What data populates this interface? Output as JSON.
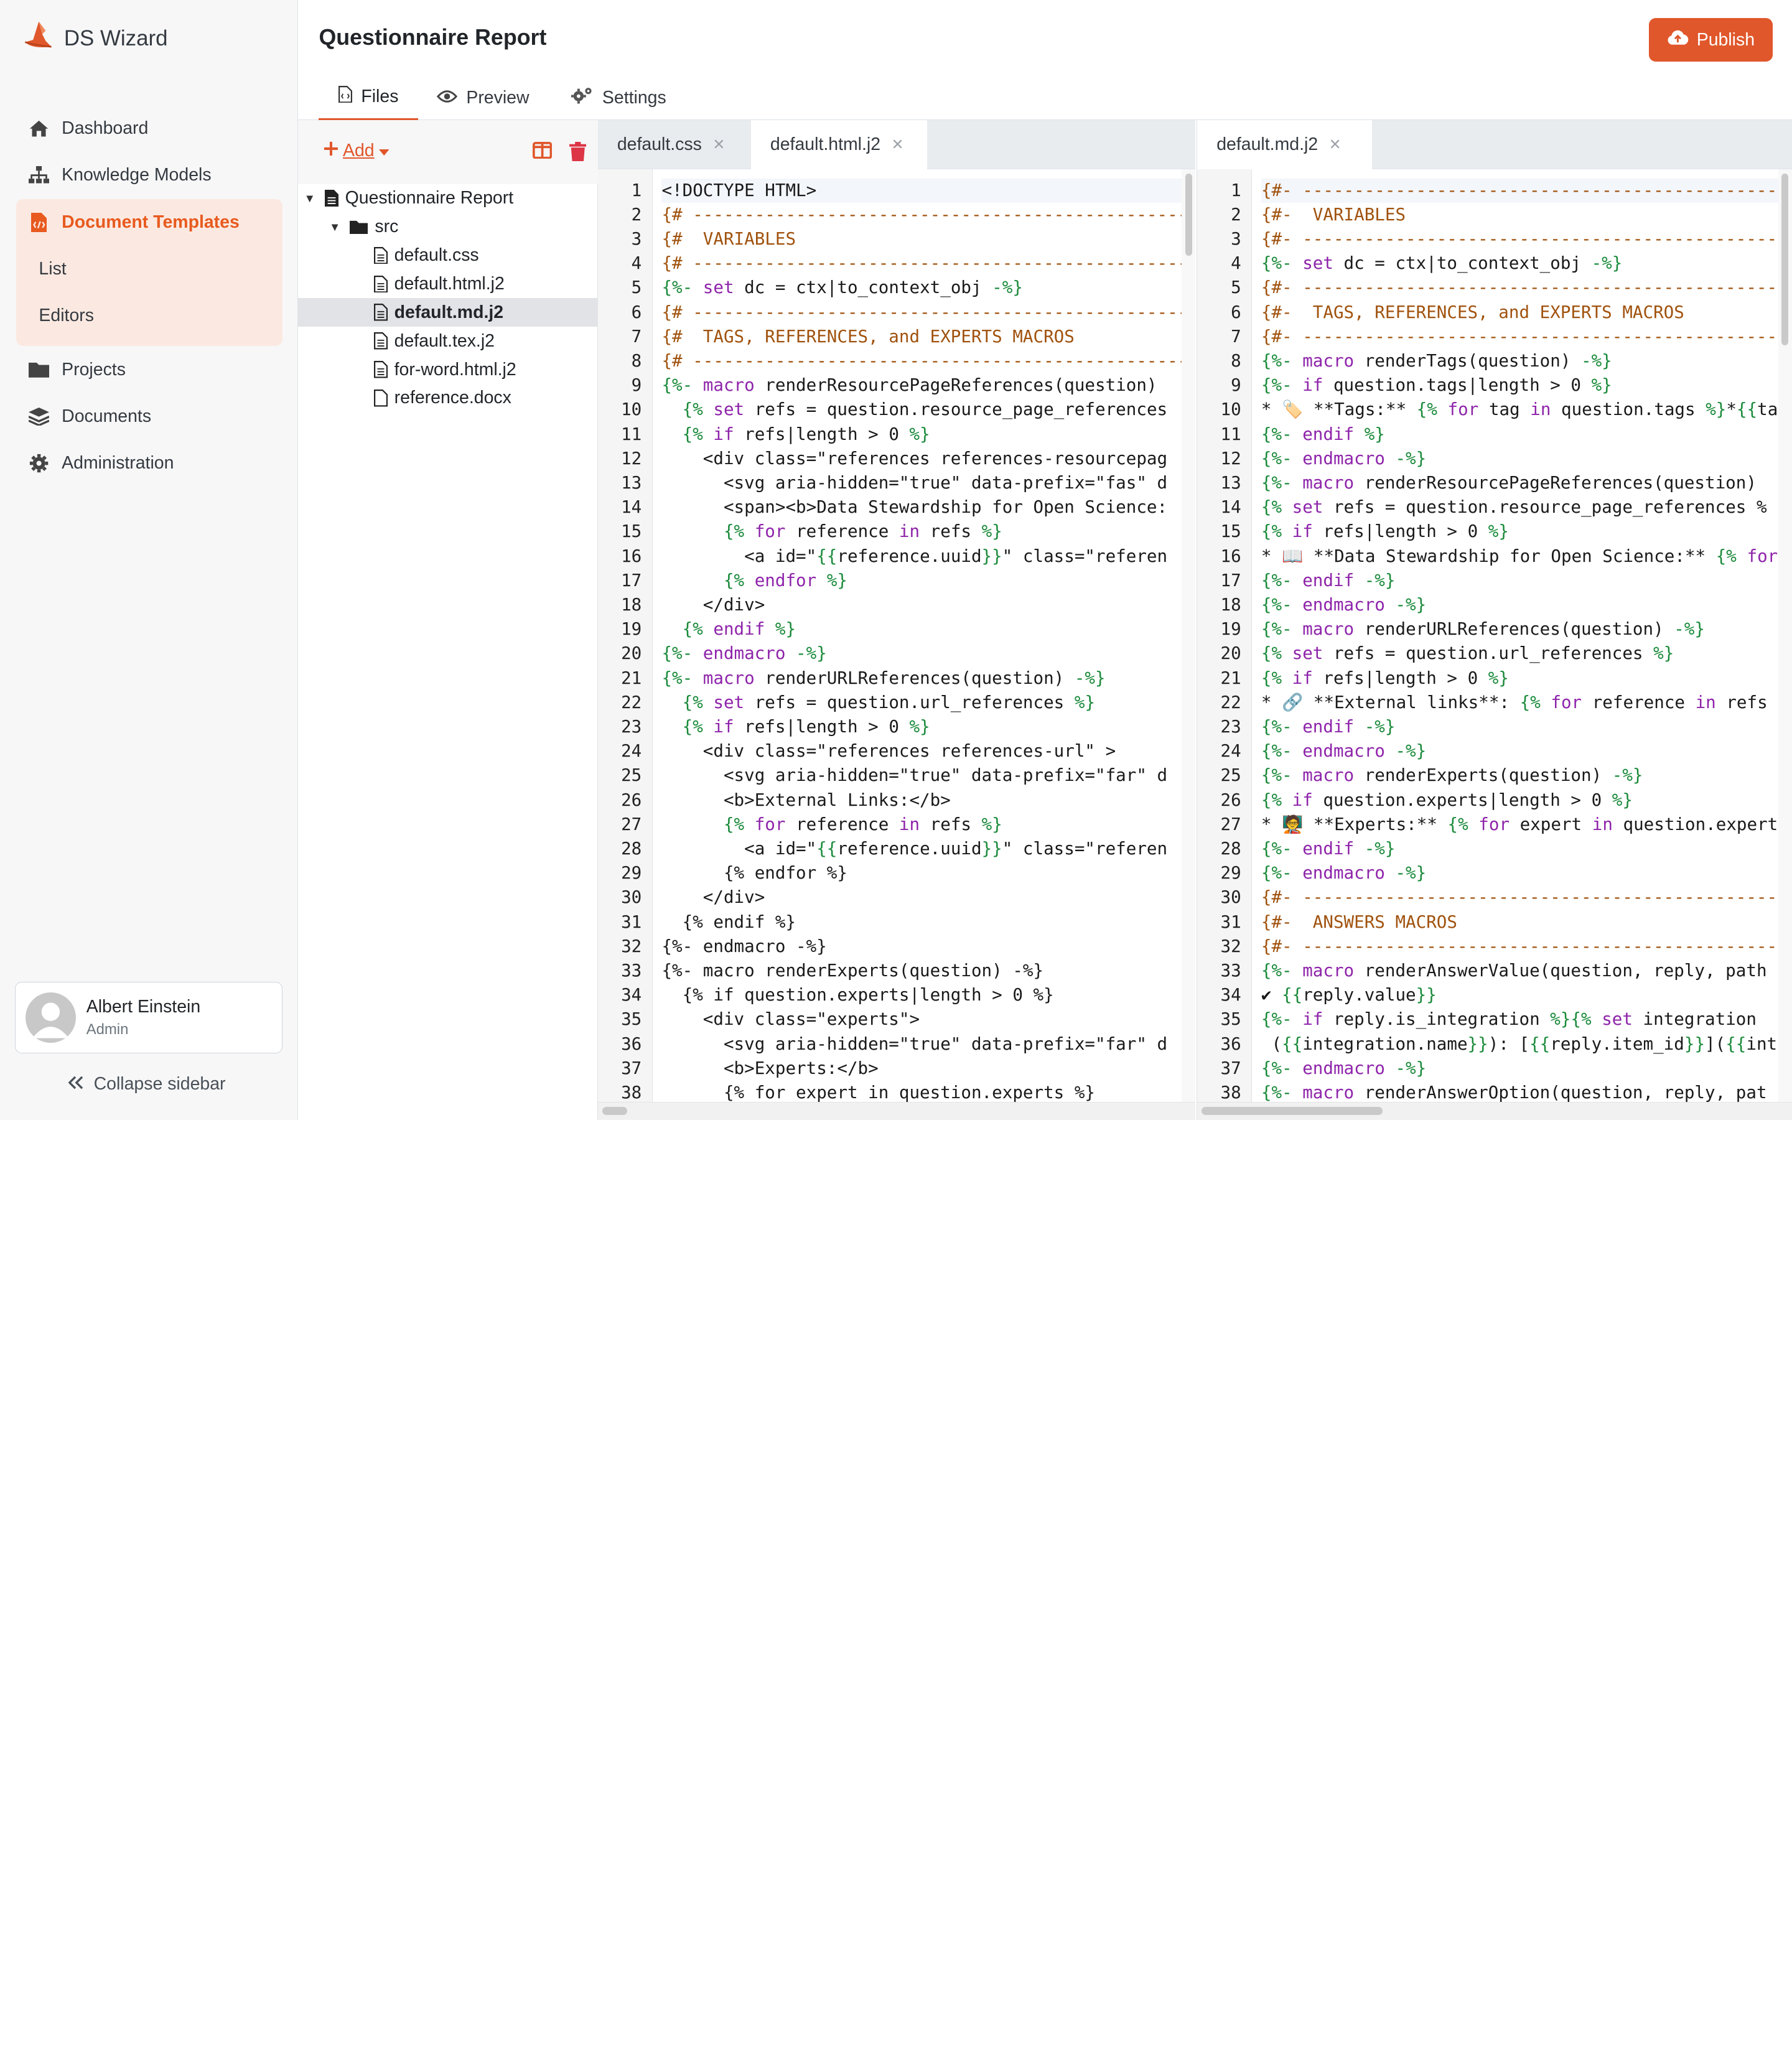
{
  "brand": {
    "name": "DS Wizard",
    "accent": "#e0572b"
  },
  "nav": {
    "dashboard": "Dashboard",
    "knowledge_models": "Knowledge Models",
    "document_templates": "Document Templates",
    "list": "List",
    "editors": "Editors",
    "projects": "Projects",
    "documents": "Documents",
    "administration": "Administration"
  },
  "user": {
    "name": "Albert Einstein",
    "role": "Admin"
  },
  "collapse_label": "Collapse sidebar",
  "header": {
    "title": "Questionnaire Report",
    "publish_label": "Publish"
  },
  "tabs": {
    "files": "Files",
    "preview": "Preview",
    "settings": "Settings"
  },
  "tree": {
    "add_label": "Add",
    "root": "Questionnaire Report",
    "folder": "src",
    "files": [
      "default.css",
      "default.html.j2",
      "default.md.j2",
      "default.tex.j2",
      "for-word.html.j2",
      "reference.docx"
    ],
    "selected": "default.md.j2"
  },
  "editor_left": {
    "tabs": [
      "default.css",
      "default.html.j2"
    ],
    "active_tab": "default.html.j2",
    "lines": [
      [
        [
          "",
          "<!DOCTYPE HTML>"
        ]
      ],
      [
        [
          "cm",
          "{# -----------------------------------------------------------"
        ]
      ],
      [
        [
          "cm",
          "{#  VARIABLES"
        ]
      ],
      [
        [
          "cm",
          "{# -----------------------------------------------------------"
        ]
      ],
      [
        [
          "tg",
          "{%- "
        ],
        [
          "kw",
          "set"
        ],
        [
          "",
          " dc = ctx|to_context_obj "
        ],
        [
          "tg",
          "-%}"
        ]
      ],
      [
        [
          "cm",
          "{# -----------------------------------------------------------"
        ]
      ],
      [
        [
          "cm",
          "{#  TAGS, REFERENCES, and EXPERTS MACROS"
        ]
      ],
      [
        [
          "cm",
          "{# -----------------------------------------------------------"
        ]
      ],
      [
        [
          "tg",
          "{%- "
        ],
        [
          "kw",
          "macro"
        ],
        [
          "",
          " renderResourcePageReferences(question)"
        ]
      ],
      [
        [
          "",
          "  "
        ],
        [
          "tg",
          "{% "
        ],
        [
          "kw",
          "set"
        ],
        [
          "",
          " refs = question.resource_page_references"
        ]
      ],
      [
        [
          "",
          "  "
        ],
        [
          "tg",
          "{% "
        ],
        [
          "kw",
          "if"
        ],
        [
          "",
          " refs|length > 0 "
        ],
        [
          "tg",
          "%}"
        ]
      ],
      [
        [
          "",
          "    <div class=\"references references-resourcepag"
        ]
      ],
      [
        [
          "",
          "      <svg aria-hidden=\"true\" data-prefix=\"fas\" d"
        ]
      ],
      [
        [
          "",
          "      <span><b>Data Stewardship for Open Science:"
        ]
      ],
      [
        [
          "",
          "      "
        ],
        [
          "tg",
          "{% "
        ],
        [
          "kw",
          "for"
        ],
        [
          "",
          " reference "
        ],
        [
          "kw",
          "in"
        ],
        [
          "",
          " refs "
        ],
        [
          "tg",
          "%}"
        ]
      ],
      [
        [
          "",
          "        <a id=\""
        ],
        [
          "tg",
          "{{"
        ],
        [
          "",
          "reference.uuid"
        ],
        [
          "tg",
          "}}"
        ],
        [
          "",
          "\" class=\"referen"
        ]
      ],
      [
        [
          "",
          "      "
        ],
        [
          "tg",
          "{% "
        ],
        [
          "kw",
          "endfor"
        ],
        [
          "tg",
          " %}"
        ]
      ],
      [
        [
          "",
          "    </div>"
        ]
      ],
      [
        [
          "",
          "  "
        ],
        [
          "tg",
          "{% "
        ],
        [
          "kw",
          "endif"
        ],
        [
          "tg",
          " %}"
        ]
      ],
      [
        [
          "tg",
          "{%- "
        ],
        [
          "kw",
          "endmacro"
        ],
        [
          "tg",
          " -%}"
        ]
      ],
      [
        [
          "tg",
          "{%- "
        ],
        [
          "kw",
          "macro"
        ],
        [
          "",
          " renderURLReferences(question) "
        ],
        [
          "tg",
          "-%}"
        ]
      ],
      [
        [
          "",
          "  "
        ],
        [
          "tg",
          "{% "
        ],
        [
          "kw",
          "set"
        ],
        [
          "",
          " refs = question.url_references "
        ],
        [
          "tg",
          "%}"
        ]
      ],
      [
        [
          "",
          "  "
        ],
        [
          "tg",
          "{% "
        ],
        [
          "kw",
          "if"
        ],
        [
          "",
          " refs|length > 0 "
        ],
        [
          "tg",
          "%}"
        ]
      ],
      [
        [
          "",
          "    <div class=\"references references-url\" >"
        ]
      ],
      [
        [
          "",
          "      <svg aria-hidden=\"true\" data-prefix=\"far\" d"
        ]
      ],
      [
        [
          "",
          "      <b>External Links:</b>"
        ]
      ],
      [
        [
          "",
          "      "
        ],
        [
          "tg",
          "{% "
        ],
        [
          "kw",
          "for"
        ],
        [
          "",
          " reference "
        ],
        [
          "kw",
          "in"
        ],
        [
          "",
          " refs "
        ],
        [
          "tg",
          "%}"
        ]
      ],
      [
        [
          "",
          "        <a id=\""
        ],
        [
          "tg",
          "{{"
        ],
        [
          "",
          "reference.uuid"
        ],
        [
          "tg",
          "}}"
        ],
        [
          "",
          "\" class=\"referen"
        ]
      ],
      [
        [
          "",
          "      {% endfor %}"
        ]
      ],
      [
        [
          "",
          "    </div>"
        ]
      ],
      [
        [
          "",
          "  {% endif %}"
        ]
      ],
      [
        [
          "",
          "{%- endmacro -%}"
        ]
      ],
      [
        [
          "",
          "{%- macro renderExperts(question) -%}"
        ]
      ],
      [
        [
          "",
          "  {% if question.experts|length > 0 %}"
        ]
      ],
      [
        [
          "",
          "    <div class=\"experts\">"
        ]
      ],
      [
        [
          "",
          "      <svg aria-hidden=\"true\" data-prefix=\"far\" d"
        ]
      ],
      [
        [
          "",
          "      <b>Experts:</b>"
        ]
      ],
      [
        [
          "",
          "      {% for expert in question.experts %}"
        ]
      ]
    ]
  },
  "editor_right": {
    "tabs": [
      "default.md.j2"
    ],
    "active_tab": "default.md.j2",
    "lines": [
      [
        [
          "cm",
          "{#- -----------------------------------------------------------"
        ]
      ],
      [
        [
          "cm",
          "{#-  VARIABLES"
        ]
      ],
      [
        [
          "cm",
          "{#- -----------------------------------------------------------"
        ]
      ],
      [
        [
          "tg",
          "{%- "
        ],
        [
          "kw",
          "set"
        ],
        [
          "",
          " dc = ctx|to_context_obj "
        ],
        [
          "tg",
          "-%}"
        ]
      ],
      [
        [
          "cm",
          "{#- -----------------------------------------------------------"
        ]
      ],
      [
        [
          "cm",
          "{#-  TAGS, REFERENCES, and EXPERTS MACROS"
        ]
      ],
      [
        [
          "cm",
          "{#- -----------------------------------------------------------"
        ]
      ],
      [
        [
          "tg",
          "{%- "
        ],
        [
          "kw",
          "macro"
        ],
        [
          "",
          " renderTags(question) "
        ],
        [
          "tg",
          "-%}"
        ]
      ],
      [
        [
          "tg",
          "{%- "
        ],
        [
          "kw",
          "if"
        ],
        [
          "",
          " question.tags|length > 0 "
        ],
        [
          "tg",
          "%}"
        ]
      ],
      [
        [
          "",
          "* 🏷️ **Tags:** "
        ],
        [
          "tg",
          "{% "
        ],
        [
          "kw",
          "for"
        ],
        [
          "",
          " tag "
        ],
        [
          "kw",
          "in"
        ],
        [
          "",
          " question.tags "
        ],
        [
          "tg",
          "%}"
        ],
        [
          "",
          "*"
        ],
        [
          "tg",
          "{{"
        ],
        [
          "",
          "ta"
        ]
      ],
      [
        [
          "tg",
          "{%- "
        ],
        [
          "kw",
          "endif"
        ],
        [
          "tg",
          " %}"
        ]
      ],
      [
        [
          "tg",
          "{%- "
        ],
        [
          "kw",
          "endmacro"
        ],
        [
          "tg",
          " -%}"
        ]
      ],
      [
        [
          "tg",
          "{%- "
        ],
        [
          "kw",
          "macro"
        ],
        [
          "",
          " renderResourcePageReferences(question)"
        ]
      ],
      [
        [
          "tg",
          "{% "
        ],
        [
          "kw",
          "set"
        ],
        [
          "",
          " refs = question.resource_page_references %"
        ]
      ],
      [
        [
          "tg",
          "{% "
        ],
        [
          "kw",
          "if"
        ],
        [
          "",
          " refs|length > 0 "
        ],
        [
          "tg",
          "%}"
        ]
      ],
      [
        [
          "",
          "* 📖 **Data Stewardship for Open Science:** "
        ],
        [
          "tg",
          "{% "
        ],
        [
          "kw",
          "for"
        ]
      ],
      [
        [
          "tg",
          "{%- "
        ],
        [
          "kw",
          "endif"
        ],
        [
          "tg",
          " -%}"
        ]
      ],
      [
        [
          "tg",
          "{%- "
        ],
        [
          "kw",
          "endmacro"
        ],
        [
          "tg",
          " -%}"
        ]
      ],
      [
        [
          "tg",
          "{%- "
        ],
        [
          "kw",
          "macro"
        ],
        [
          "",
          " renderURLReferences(question) "
        ],
        [
          "tg",
          "-%}"
        ]
      ],
      [
        [
          "tg",
          "{% "
        ],
        [
          "kw",
          "set"
        ],
        [
          "",
          " refs = question.url_references "
        ],
        [
          "tg",
          "%}"
        ]
      ],
      [
        [
          "tg",
          "{% "
        ],
        [
          "kw",
          "if"
        ],
        [
          "",
          " refs|length > 0 "
        ],
        [
          "tg",
          "%}"
        ]
      ],
      [
        [
          "",
          "* 🔗 **External links**: "
        ],
        [
          "tg",
          "{% "
        ],
        [
          "kw",
          "for"
        ],
        [
          "",
          " reference "
        ],
        [
          "kw",
          "in"
        ],
        [
          "",
          " refs"
        ]
      ],
      [
        [
          "tg",
          "{%- "
        ],
        [
          "kw",
          "endif"
        ],
        [
          "tg",
          " -%}"
        ]
      ],
      [
        [
          "tg",
          "{%- "
        ],
        [
          "kw",
          "endmacro"
        ],
        [
          "tg",
          " -%}"
        ]
      ],
      [
        [
          "tg",
          "{%- "
        ],
        [
          "kw",
          "macro"
        ],
        [
          "",
          " renderExperts(question) "
        ],
        [
          "tg",
          "-%}"
        ]
      ],
      [
        [
          "tg",
          "{% "
        ],
        [
          "kw",
          "if"
        ],
        [
          "",
          " question.experts|length > 0 "
        ],
        [
          "tg",
          "%}"
        ]
      ],
      [
        [
          "",
          "* 🧑‍🏫 **Experts:** "
        ],
        [
          "tg",
          "{% "
        ],
        [
          "kw",
          "for"
        ],
        [
          "",
          " expert "
        ],
        [
          "kw",
          "in"
        ],
        [
          "",
          " question.expert"
        ]
      ],
      [
        [
          "tg",
          "{%- "
        ],
        [
          "kw",
          "endif"
        ],
        [
          "tg",
          " -%}"
        ]
      ],
      [
        [
          "tg",
          "{%- "
        ],
        [
          "kw",
          "endmacro"
        ],
        [
          "tg",
          " -%}"
        ]
      ],
      [
        [
          "cm",
          "{#- -----------------------------------------------------------"
        ]
      ],
      [
        [
          "cm",
          "{#-  ANSWERS MACROS"
        ]
      ],
      [
        [
          "cm",
          "{#- -----------------------------------------------------------"
        ]
      ],
      [
        [
          "tg",
          "{%- "
        ],
        [
          "kw",
          "macro"
        ],
        [
          "",
          " renderAnswerValue(question, reply, path"
        ]
      ],
      [
        [
          "",
          "✔ "
        ],
        [
          "tg",
          "{{"
        ],
        [
          "",
          "reply.value"
        ],
        [
          "tg",
          "}}"
        ]
      ],
      [
        [
          "tg",
          "{%- "
        ],
        [
          "kw",
          "if"
        ],
        [
          "",
          " reply.is_integration "
        ],
        [
          "tg",
          "%}{% "
        ],
        [
          "kw",
          "set"
        ],
        [
          "",
          " integration"
        ]
      ],
      [
        [
          "",
          " ("
        ],
        [
          "tg",
          "{{"
        ],
        [
          "",
          "integration.name"
        ],
        [
          "tg",
          "}}"
        ],
        [
          "",
          "): ["
        ],
        [
          "tg",
          "{{"
        ],
        [
          "",
          "reply.item_id"
        ],
        [
          "tg",
          "}}"
        ],
        [
          "",
          "]("
        ],
        [
          "tg",
          "{{"
        ],
        [
          "",
          "int"
        ]
      ],
      [
        [
          "tg",
          "{%- "
        ],
        [
          "kw",
          "endmacro"
        ],
        [
          "tg",
          " -%}"
        ]
      ],
      [
        [
          "tg",
          "{%- "
        ],
        [
          "kw",
          "macro"
        ],
        [
          "",
          " renderAnswerOption(question, reply, pat"
        ]
      ]
    ]
  }
}
